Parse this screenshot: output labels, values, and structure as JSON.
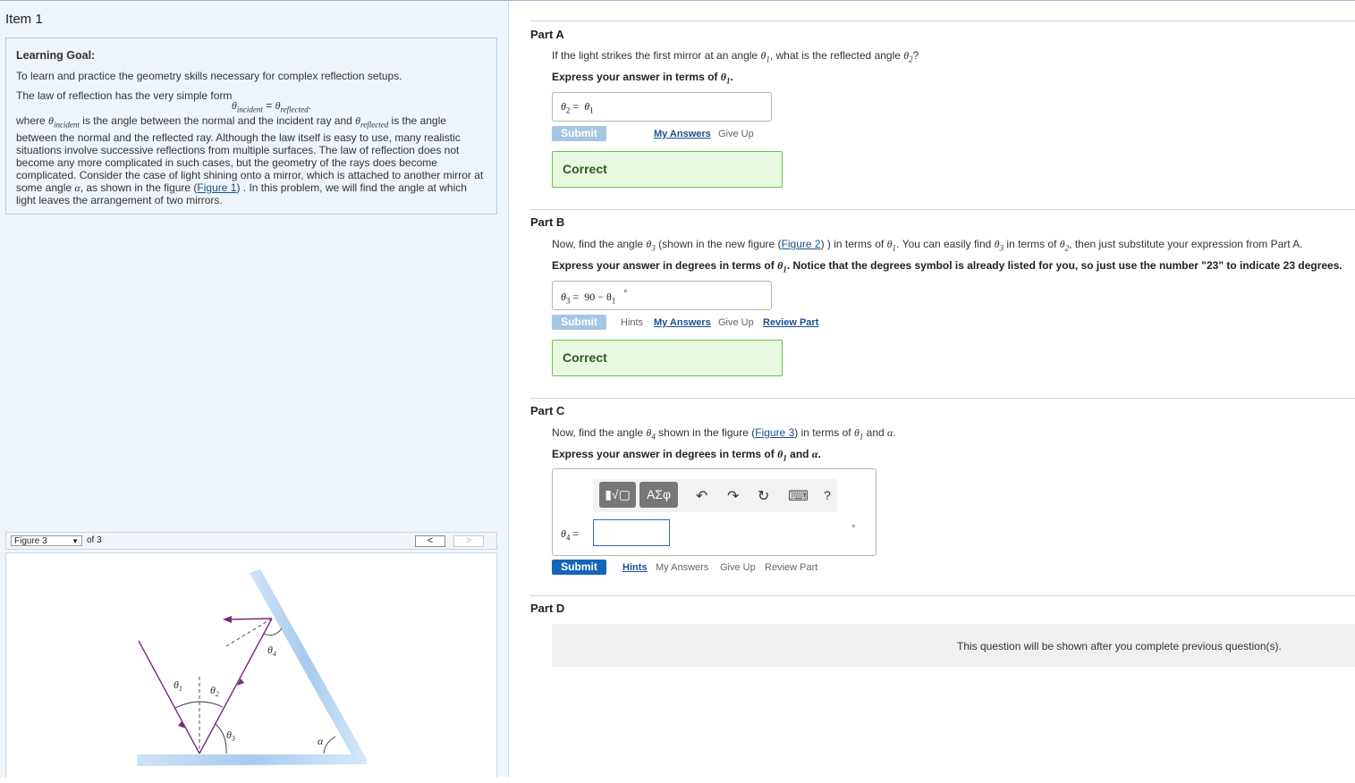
{
  "item_title": "Item 1",
  "learning_goal": {
    "heading": "Learning Goal:",
    "intro": "To learn and practice the geometry skills necessary for complex reflection setups.",
    "law_intro": "The law of reflection has the very simple form",
    "eq_lhs": "θ",
    "eq_lhs_sub": "incident",
    "eq_eq": " = ",
    "eq_rhs": "θ",
    "eq_rhs_sub": "reflected",
    "eq_end": ".",
    "where": "where ",
    "theta": "θ",
    "incident_sub": "incident",
    "text1": " is the angle between the normal and the incident ray and ",
    "reflected_sub": "reflected",
    "text2": " is the angle between the normal and the reflected ray. Although the law itself is easy to use, many realistic situations involve successive reflections from multiple surfaces. The law of reflection does not become any more complicated in such cases, but the geometry of the rays does become complicated. Consider the case of light shining onto a mirror, which is attached to another mirror at some angle ",
    "alpha": "α",
    "text3": ", as shown in the figure (",
    "figure1_link": "Figure 1",
    "text4": ") . In this problem, we will find the angle at which light leaves the arrangement of two mirrors."
  },
  "figure_nav": {
    "selected": "Figure 3",
    "of_text": "of 3",
    "prev": "<",
    "next": ">"
  },
  "figure": {
    "label_theta1": "θ",
    "label_theta1_sub": "1",
    "label_theta2": "θ",
    "label_theta2_sub": "2",
    "label_theta3": "θ",
    "label_theta3_sub": "3",
    "label_theta4": "θ",
    "label_theta4_sub": "4",
    "label_alpha": "α"
  },
  "partA": {
    "title": "Part A",
    "q1": "If the light strikes the first mirror at an angle ",
    "theta": "θ",
    "sub1": "1",
    "q2": ", what is the reflected angle ",
    "sub2": "2",
    "q3": "?",
    "instr1": "Express your answer in terms of ",
    "instr2": ".",
    "answer_lhs": "θ",
    "answer_lhs_sub": "2",
    "answer_eq": " = ",
    "answer_val": "θ",
    "answer_val_sub": "1",
    "submit": "Submit",
    "my_answers": "My Answers",
    "give_up": "Give Up",
    "feedback": "Correct"
  },
  "partB": {
    "title": "Part B",
    "q1": "Now, find the angle ",
    "q2": " (shown in the new figure (",
    "figure2_link": "Figure 2",
    "q3": ") ) in terms of ",
    "q4": ". You can easily find ",
    "q5": " in terms of ",
    "q6": ", then just substitute your expression from Part A.",
    "instr1": "Express your answer in degrees in terms of ",
    "instr2": ". Notice that the degrees symbol is already listed for you, so just use the number \"23\" to indicate 23 degrees.",
    "answer_lhs_sub": "3",
    "answer_eq": " =  ",
    "answer_val": "90 − θ",
    "answer_val_sub": "1",
    "degree": "°",
    "submit": "Submit",
    "hints": "Hints",
    "my_answers": "My Answers",
    "give_up": "Give Up",
    "review_part": "Review Part",
    "feedback": "Correct"
  },
  "partC": {
    "title": "Part C",
    "q1": "Now, find the angle ",
    "q2": " shown in the figure (",
    "figure3_link": "Figure 3",
    "q3": ") in terms of ",
    "q4": " and ",
    "alpha": "α",
    "q5": ".",
    "instr1": "Express your answer in degrees in terms of ",
    "instr2": " and ",
    "instr3": ".",
    "toolbar_templates": "▮√▢",
    "toolbar_symbols": "ΑΣφ",
    "toolbar_undo": "↶",
    "toolbar_redo": "↷",
    "toolbar_reset": "↻",
    "toolbar_keyboard": "⌨",
    "toolbar_help": "?",
    "answer_lhs_sub": "4",
    "answer_eq": " =",
    "degree": "°",
    "submit": "Submit",
    "hints": "Hints",
    "my_answers": "My Answers",
    "give_up": "Give Up",
    "review_part": "Review Part"
  },
  "partD": {
    "title": "Part D",
    "locked_message": "This question will be shown after you complete previous question(s)."
  }
}
